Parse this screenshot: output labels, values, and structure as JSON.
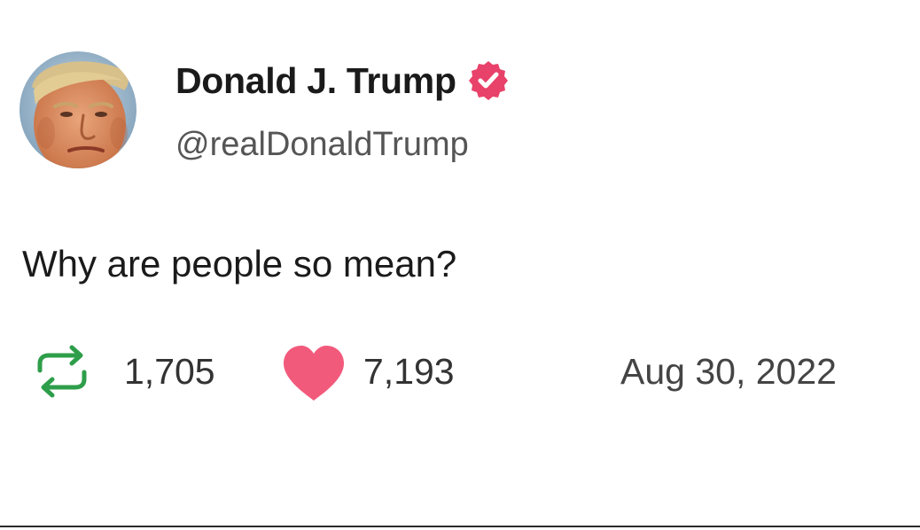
{
  "author": {
    "display_name": "Donald J. Trump",
    "handle": "@realDonaldTrump",
    "verified": true,
    "badge_color": "#e8416a",
    "avatar_icon": "profile-photo"
  },
  "post": {
    "text": "Why are people so mean?",
    "date": "Aug 30, 2022"
  },
  "stats": {
    "reposts": "1,705",
    "likes": "7,193",
    "repost_icon": "repost-icon",
    "like_icon": "heart-icon",
    "repost_color": "#2e9e4a",
    "like_color": "#f25a7c"
  }
}
